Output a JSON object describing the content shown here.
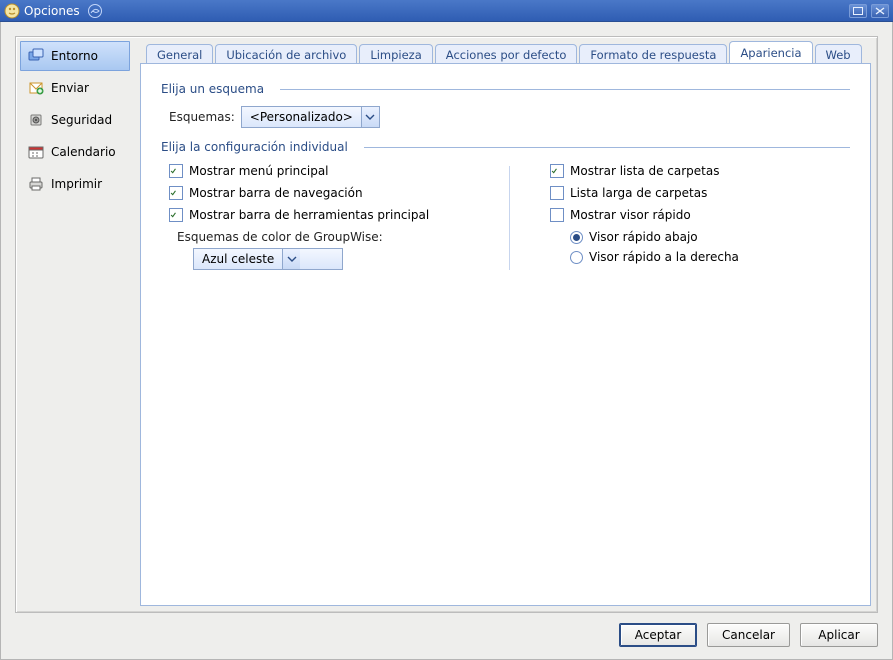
{
  "window": {
    "title": "Opciones"
  },
  "sidebar": {
    "items": [
      {
        "label": "Entorno"
      },
      {
        "label": "Enviar"
      },
      {
        "label": "Seguridad"
      },
      {
        "label": "Calendario"
      },
      {
        "label": "Imprimir"
      }
    ],
    "selected_index": 0
  },
  "tabs": {
    "items": [
      {
        "label": "General"
      },
      {
        "label": "Ubicación de archivo"
      },
      {
        "label": "Limpieza"
      },
      {
        "label": "Acciones por defecto"
      },
      {
        "label": "Formato de respuesta"
      },
      {
        "label": "Apariencia"
      },
      {
        "label": "Web"
      }
    ],
    "active_index": 5
  },
  "appearance": {
    "scheme_group_label": "Elija un esquema",
    "scheme_label": "Esquemas:",
    "scheme_value": "<Personalizado>",
    "individual_group_label": "Elija la configuración individual",
    "left": {
      "show_main_menu": {
        "label": "Mostrar menú principal",
        "checked": true
      },
      "show_nav_bar": {
        "label": "Mostrar barra de navegación",
        "checked": true
      },
      "show_main_toolbar": {
        "label": "Mostrar barra de herramientas principal",
        "checked": true
      },
      "color_scheme_label": "Esquemas de color de GroupWise:",
      "color_scheme_value": "Azul celeste"
    },
    "right": {
      "show_folder_list": {
        "label": "Mostrar lista de carpetas",
        "checked": true
      },
      "long_folder_list": {
        "label": "Lista larga de carpetas",
        "checked": false
      },
      "show_quick_viewer": {
        "label": "Mostrar visor rápido",
        "checked": false
      },
      "quick_viewer_position": {
        "below": {
          "label": "Visor rápido abajo",
          "selected": true
        },
        "right": {
          "label": "Visor rápido a la derecha",
          "selected": false
        }
      }
    }
  },
  "buttons": {
    "ok": "Aceptar",
    "cancel": "Cancelar",
    "apply": "Aplicar"
  }
}
